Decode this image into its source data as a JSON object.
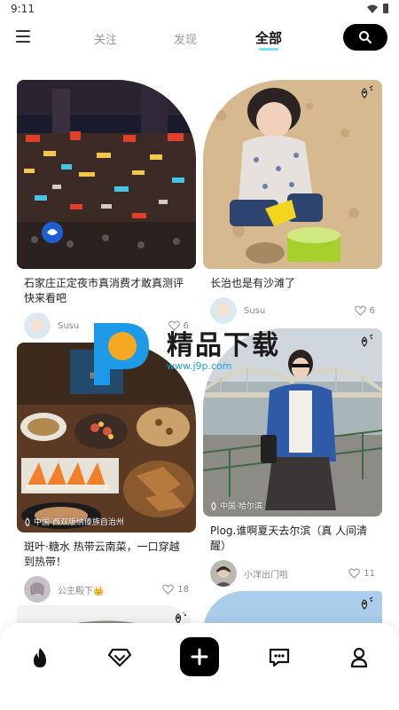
{
  "status_bar": {
    "time": "9:11"
  },
  "header": {
    "tabs": [
      {
        "label": "关注"
      },
      {
        "label": "发现"
      },
      {
        "label": "全部"
      }
    ],
    "active_tab": "全部"
  },
  "feed": {
    "cards": [
      {
        "title": "石家庄正定夜市真消费才敢真测评快来看吧",
        "user": "Susu",
        "likes": "6",
        "location": ""
      },
      {
        "title": "长治也是有沙滩了",
        "user": "Susu",
        "likes": "6",
        "location": ""
      },
      {
        "title": "斑叶·糖水 热带云南菜，一口穿越到热带！",
        "user": "公主殿下👑",
        "likes": "18",
        "location": "中国·西双版纳傣族自治州"
      },
      {
        "title": "Plog.谁啊夏天去尔滨（真 人间清醒）",
        "user": "小洋出门啦",
        "likes": "11",
        "location": "中国·哈尔滨"
      }
    ]
  },
  "watermark": {
    "text": "精品下载",
    "url": "www.j9p.com"
  },
  "colors": {
    "accent": "#7ee0ff",
    "primary": "#000000",
    "watermark_blue": "#1e9be8"
  },
  "bottom_nav": {
    "items": [
      {
        "icon": "fire-icon"
      },
      {
        "icon": "gem-icon"
      },
      {
        "icon": "plus-icon"
      },
      {
        "icon": "chat-icon"
      },
      {
        "icon": "user-icon"
      }
    ]
  }
}
